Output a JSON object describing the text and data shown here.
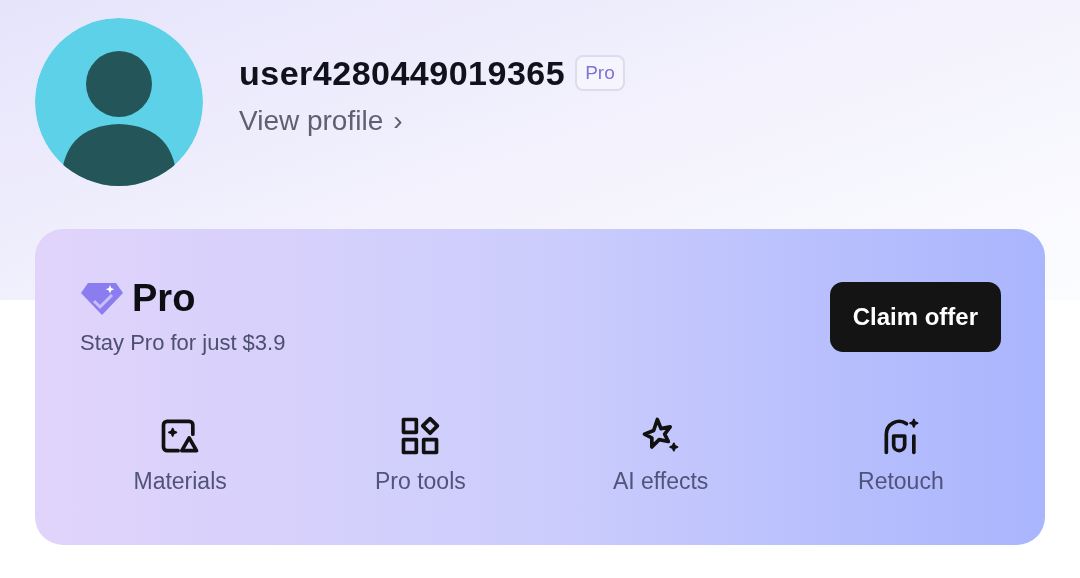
{
  "profile": {
    "username": "user4280449019365",
    "badge": "Pro",
    "link": "View profile",
    "link_arrow": "›"
  },
  "pro_card": {
    "title": "Pro",
    "subtitle": "Stay Pro for just $3.9",
    "button": "Claim offer",
    "features": [
      {
        "kind": "materials",
        "label": "Materials"
      },
      {
        "kind": "tools",
        "label": "Pro tools"
      },
      {
        "kind": "effects",
        "label": "AI effects"
      },
      {
        "kind": "retouch",
        "label": "Retouch"
      }
    ]
  }
}
